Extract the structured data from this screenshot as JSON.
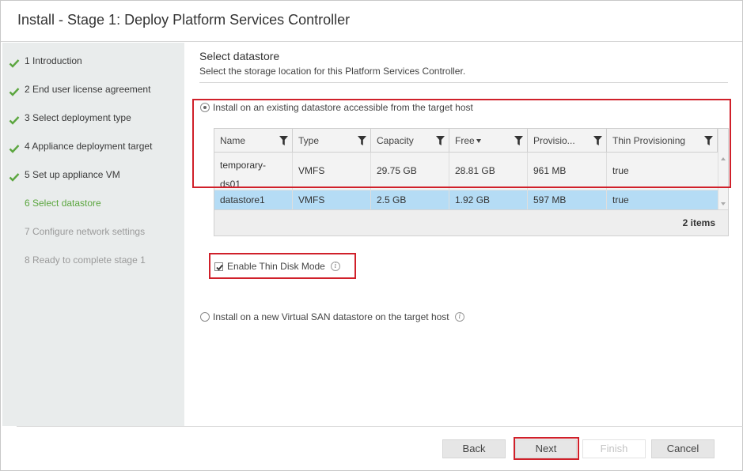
{
  "window": {
    "title": "Install - Stage 1: Deploy Platform Services Controller"
  },
  "sidebar": {
    "steps": [
      {
        "label": "1 Introduction",
        "state": "done"
      },
      {
        "label": "2 End user license agreement",
        "state": "done"
      },
      {
        "label": "3 Select deployment type",
        "state": "done"
      },
      {
        "label": "4 Appliance deployment target",
        "state": "done"
      },
      {
        "label": "5 Set up appliance VM",
        "state": "done"
      },
      {
        "label": "6 Select datastore",
        "state": "current"
      },
      {
        "label": "7 Configure network settings",
        "state": "future"
      },
      {
        "label": "8 Ready to complete stage 1",
        "state": "future"
      }
    ],
    "check_icon": "checkmark-icon",
    "check_color": "#5ba63f"
  },
  "main": {
    "title": "Select datastore",
    "subtitle": "Select the storage location for this Platform Services Controller.",
    "option_existing": {
      "label": "Install on an existing datastore accessible from the target host",
      "selected": true
    },
    "grid": {
      "columns": [
        "Name",
        "Type",
        "Capacity",
        "Free",
        "Provisio...",
        "Thin Provisioning"
      ],
      "sorted_column": "Free",
      "rows": [
        {
          "name": "temporary-ds01",
          "type": "VMFS",
          "capacity": "29.75 GB",
          "free": "28.81 GB",
          "provisioned": "961 MB",
          "thin": "true"
        },
        {
          "name": "datastore1",
          "type": "VMFS",
          "capacity": "2.5 GB",
          "free": "1.92 GB",
          "provisioned": "597 MB",
          "thin": "true",
          "selected": true
        }
      ],
      "item_count": "2 items"
    },
    "thin_disk": {
      "label": "Enable Thin Disk Mode",
      "checked": true
    },
    "option_vsan": {
      "label": "Install on a new Virtual SAN datastore on the target host",
      "selected": false
    }
  },
  "buttons": {
    "back": "Back",
    "next": "Next",
    "finish": "Finish",
    "cancel": "Cancel"
  },
  "colors": {
    "accent_green": "#5ba63f",
    "selection_blue": "#b5dcf5",
    "highlight_red": "#d0202a"
  }
}
